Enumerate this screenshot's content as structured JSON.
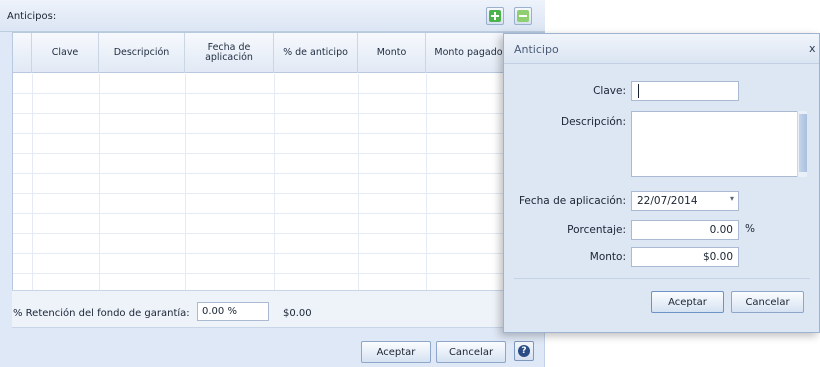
{
  "main": {
    "title": "Anticipos:",
    "add_icon": "plus-icon",
    "remove_icon": "minus-icon",
    "columns": [
      "Clave",
      "Descripción",
      "Fecha de aplicación",
      "% de anticipo",
      "Monto",
      "Monto pagado"
    ],
    "retencion_label": "% Retención del fondo de garantía:",
    "retencion_value": "0.00 %",
    "retencion_amount": "$0.00",
    "accept_label": "Aceptar",
    "cancel_label": "Cancelar",
    "help_icon": "question-icon",
    "help_glyph": "?"
  },
  "dialog": {
    "title": "Anticipo",
    "close_label": "x",
    "clave_label": "Clave:",
    "clave_value": "",
    "descripcion_label": "Descripción:",
    "descripcion_value": "",
    "fecha_label": "Fecha de aplicación:",
    "fecha_value": "22/07/2014",
    "fecha_arrow": "▾",
    "porcentaje_label": "Porcentaje:",
    "porcentaje_value": "0.00",
    "porcentaje_unit": "%",
    "monto_label": "Monto:",
    "monto_value": "$0.00",
    "accept_label": "Aceptar",
    "cancel_label": "Cancelar"
  },
  "colors": {
    "panel_bg": "#dfe8f6",
    "accent_green": "#4cb34a",
    "help_blue": "#2b4d86"
  }
}
